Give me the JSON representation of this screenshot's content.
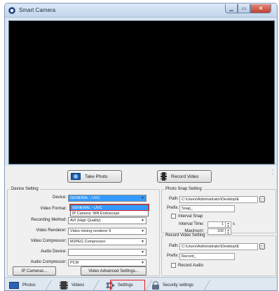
{
  "window": {
    "title": "Smart Camera",
    "minimize_glyph": "▁",
    "maximize_glyph": "▭",
    "close_glyph": "✕"
  },
  "actions": {
    "take_photo": "Take Photo",
    "record_video": "Record Video"
  },
  "device": {
    "legend": "Device Setting",
    "device_label": "Device:",
    "device_value": "GENERAL - UVC",
    "format_label": "Video Format:",
    "recording_label": "Recording Method:",
    "recording_value": "AVI (High Quality)",
    "renderer_label": "Video Renderer:",
    "renderer_value": "Video mixing renderer 9",
    "vcomp_label": "Video Compressor:",
    "vcomp_value": "MJPEG Compressor",
    "audio_label": "Audio Device:",
    "audio_value": "",
    "acomp_label": "Audio Compressor:",
    "acomp_value": "PCM",
    "ip_button": "IP Cameras...",
    "advanced_button": "Video Advanced Settings...",
    "dropdown_options": [
      "GENERAL - UVC",
      "IP Camera: Wifi Endoscope"
    ]
  },
  "photo": {
    "legend": "Photo Snap Setting",
    "path_label": "Path:",
    "path_value": "C:\\Users\\Administrator\\Desktop\\E",
    "prefix_label": "Prefix:",
    "prefix_value": "Snap_",
    "interval_check": "Interval Snap",
    "interval_label": "Interval Time:",
    "interval_value": "1",
    "interval_unit": "s",
    "max_label": "Maximum:",
    "max_value": "100",
    "browse": "..."
  },
  "video": {
    "legend": "Record Video Setting",
    "path_label": "Path:",
    "path_value": "C:\\Users\\Administrator\\Desktop\\E",
    "prefix_label": "Prefix:",
    "prefix_value": "Record_",
    "audio_check": "Record Audio",
    "browse": "..."
  },
  "tabs": [
    {
      "label": "Photos",
      "icon": "photo-icon"
    },
    {
      "label": "Videos",
      "icon": "video-icon"
    },
    {
      "label": "Settings",
      "icon": "gear-icon"
    },
    {
      "label": "Security settings",
      "icon": "lock-icon"
    }
  ],
  "colors": {
    "highlight": "#3399ff",
    "callout": "#e02020",
    "preview_bg": "#000000"
  }
}
